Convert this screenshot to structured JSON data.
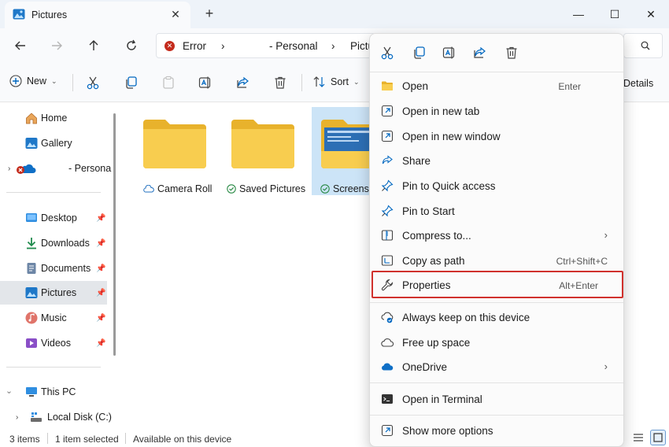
{
  "window": {
    "tab_title": "Pictures",
    "tab_close": "✕",
    "new_tab": "+",
    "minimize": "—",
    "maximize": "☐",
    "close": "✕"
  },
  "address": {
    "segments": [
      "Error",
      "- Personal",
      "Pictu"
    ],
    "separator": "›"
  },
  "commands": {
    "new_label": "New",
    "sort_label": "Sort",
    "details_label": "Details"
  },
  "sidebar": {
    "items": [
      {
        "label": "Home"
      },
      {
        "label": "Gallery"
      },
      {
        "label": "- Persona"
      },
      {
        "label": "Desktop"
      },
      {
        "label": "Downloads"
      },
      {
        "label": "Documents"
      },
      {
        "label": "Pictures"
      },
      {
        "label": "Music"
      },
      {
        "label": "Videos"
      },
      {
        "label": "This PC"
      },
      {
        "label": "Local Disk (C:)"
      }
    ]
  },
  "files": [
    {
      "name": "Camera Roll",
      "status": "cloud"
    },
    {
      "name": "Saved Pictures",
      "status": "synced"
    },
    {
      "name": "Screensh",
      "status": "synced"
    }
  ],
  "status_bar": {
    "items": "3 items",
    "selected": "1 item selected",
    "availability": "Available on this device"
  },
  "context_menu": {
    "items": [
      {
        "label": "Open",
        "shortcut": "Enter",
        "icon": "folder-icon"
      },
      {
        "label": "Open in new tab",
        "icon": "new-tab-icon"
      },
      {
        "label": "Open in new window",
        "icon": "new-window-icon"
      },
      {
        "label": "Share",
        "icon": "share-icon"
      },
      {
        "label": "Pin to Quick access",
        "icon": "pin-icon"
      },
      {
        "label": "Pin to Start",
        "icon": "pin-icon"
      },
      {
        "label": "Compress to...",
        "icon": "zip-icon",
        "arrow": "›"
      },
      {
        "label": "Copy as path",
        "shortcut": "Ctrl+Shift+C",
        "icon": "copy-path-icon"
      },
      {
        "label": "Properties",
        "shortcut": "Alt+Enter",
        "icon": "wrench-icon"
      },
      {
        "label": "Always keep on this device",
        "icon": "cloud-sync-icon"
      },
      {
        "label": "Free up space",
        "icon": "cloud-icon"
      },
      {
        "label": "OneDrive",
        "icon": "onedrive-icon",
        "arrow": "›"
      },
      {
        "label": "Open in Terminal",
        "icon": "terminal-icon"
      },
      {
        "label": "Show more options",
        "icon": "more-options-icon"
      }
    ]
  },
  "colors": {
    "accent": "#0067c0",
    "highlight_border": "#d0312d",
    "folder": "#f8c945",
    "selection": "#cce4f7"
  }
}
